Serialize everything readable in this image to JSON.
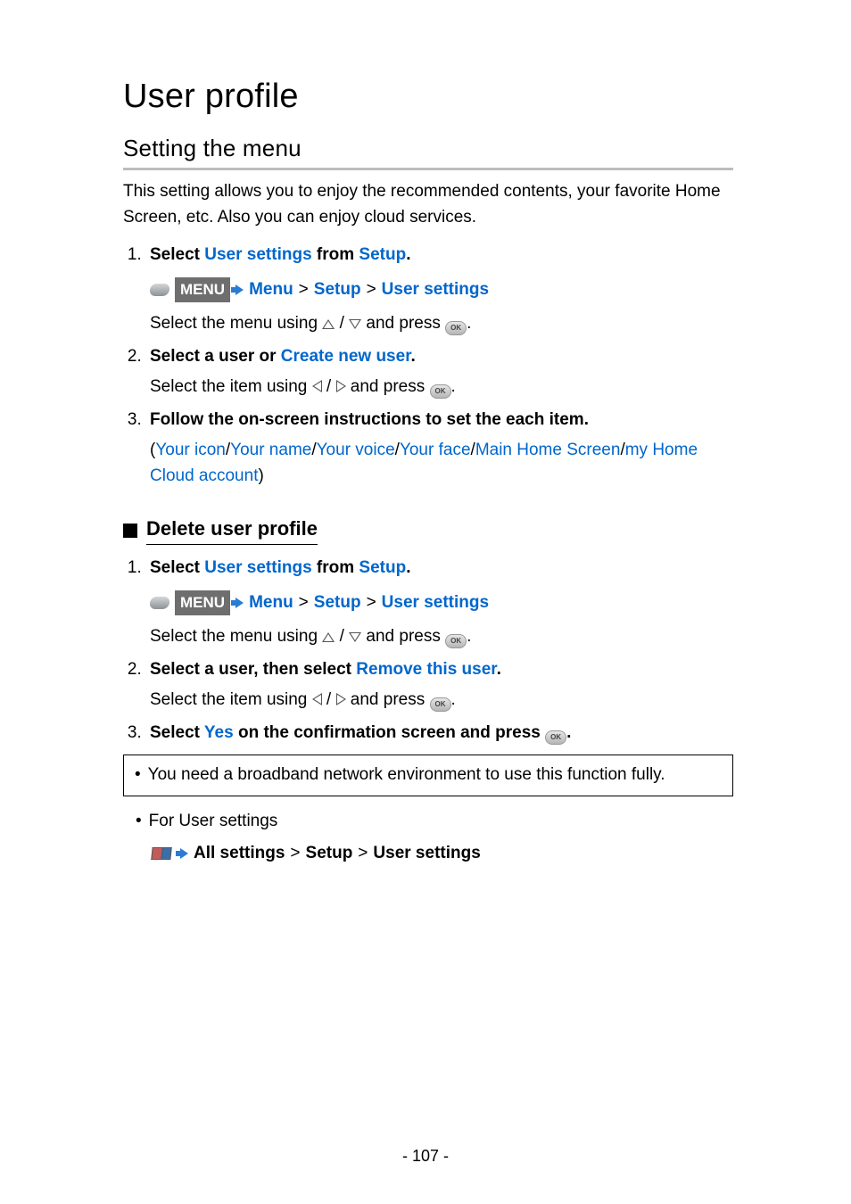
{
  "title": "User profile",
  "subtitle": "Setting the menu",
  "intro": "This setting allows you to enjoy the recommended contents, your favorite Home Screen, etc. Also you can enjoy cloud services.",
  "menu_badge": "MENU",
  "path": {
    "menu": "Menu",
    "setup": "Setup",
    "user_settings": "User settings"
  },
  "step1": {
    "pre": "Select ",
    "a": "User settings",
    "mid": " from ",
    "b": "Setup",
    "post": ".",
    "instr_a": "Select the menu using ",
    "instr_b": " / ",
    "instr_c": " and press ",
    "instr_d": "."
  },
  "step2": {
    "pre": "Select a user or ",
    "a": "Create new user",
    "post": ".",
    "instr_a": "Select the item using ",
    "instr_b": " / ",
    "instr_c": " and press ",
    "instr_d": "."
  },
  "step3": {
    "title": "Follow the on-screen instructions to set the each item.",
    "open": "(",
    "items": [
      "Your icon",
      "Your name",
      "Your voice",
      "Your face",
      "Main Home Screen",
      "my Home Cloud account"
    ],
    "sep": "/",
    "close": ")"
  },
  "del_heading": "Delete user profile",
  "d1": {
    "pre": "Select ",
    "a": "User settings",
    "mid": " from ",
    "b": "Setup",
    "post": ".",
    "instr_a": "Select the menu using ",
    "instr_b": " / ",
    "instr_c": " and press ",
    "instr_d": "."
  },
  "d2": {
    "pre": "Select a user, then select ",
    "a": "Remove this user",
    "post": ".",
    "instr_a": "Select the item using ",
    "instr_b": " / ",
    "instr_c": " and press ",
    "instr_d": "."
  },
  "d3": {
    "pre": "Select ",
    "a": "Yes",
    "mid": " on the confirmation screen and press ",
    "post": "."
  },
  "note": "You need a broadband network environment to use this function fully.",
  "for_settings": "For User settings",
  "ref": {
    "a": "All settings",
    "b": "Setup",
    "c": "User settings"
  },
  "gt": ">",
  "ok": "OK",
  "page_num": "- 107 -"
}
